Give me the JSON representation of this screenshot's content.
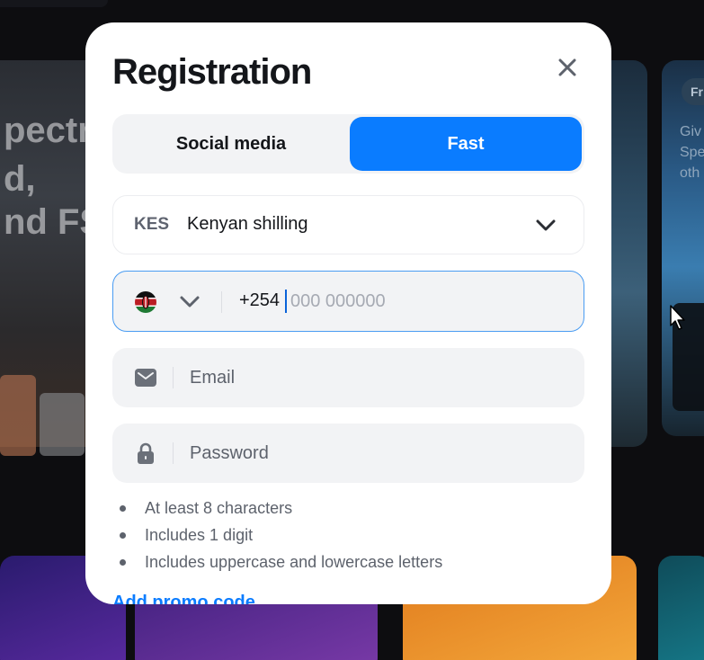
{
  "modal": {
    "title": "Registration",
    "close_icon": "close-icon"
  },
  "tabs": [
    {
      "label": "Social media",
      "active": false
    },
    {
      "label": "Fast",
      "active": true
    }
  ],
  "currency": {
    "code": "KES",
    "name": "Kenyan shilling",
    "icon": "chevron-down-icon"
  },
  "phone": {
    "country_flag": "kenya-flag-icon",
    "prefix": "+254",
    "placeholder": "000 000000"
  },
  "email": {
    "icon": "envelope-icon",
    "placeholder": "Email"
  },
  "password": {
    "icon": "lock-icon",
    "placeholder": "Password"
  },
  "password_rules": [
    "At least 8 characters",
    "Includes 1 digit",
    "Includes uppercase and lowercase letters"
  ],
  "promo_link": "Add promo code",
  "background": {
    "left_banner_lines": [
      "pectr",
      "d,",
      "nd FS"
    ],
    "right_chip": "Fr",
    "right_text": [
      "Giv",
      "Spe",
      "oth"
    ]
  },
  "colors": {
    "accent": "#0a7cff",
    "field_bg": "#f2f3f5",
    "focus_border": "#4a9cf2",
    "text": "#14161a",
    "muted": "#5d626c"
  }
}
